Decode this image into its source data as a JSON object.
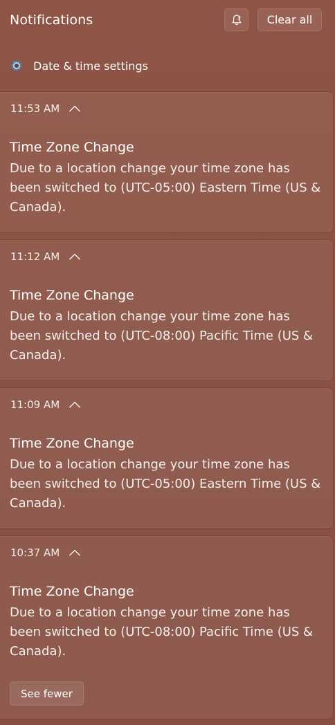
{
  "panel": {
    "title": "Notifications",
    "dnd_icon": "snooze-bell-icon",
    "clear_all_label": "Clear all"
  },
  "group": {
    "icon": "gear-icon",
    "label": "Date & time settings"
  },
  "notifications": [
    {
      "time": "11:53 AM",
      "title": "Time Zone Change",
      "body": "Due to a location change your time zone has been switched to (UTC-05:00) Eastern Time (US & Canada)."
    },
    {
      "time": "11:12 AM",
      "title": "Time Zone Change",
      "body": "Due to a location change your time zone has been switched to (UTC-08:00) Pacific Time (US & Canada)."
    },
    {
      "time": "11:09 AM",
      "title": "Time Zone Change",
      "body": "Due to a location change your time zone has been switched to (UTC-05:00) Eastern Time (US & Canada)."
    },
    {
      "time": "10:37 AM",
      "title": "Time Zone Change",
      "body": "Due to a location change your time zone has been switched to (UTC-08:00) Pacific Time (US & Canada)."
    }
  ],
  "see_fewer_label": "See fewer",
  "colors": {
    "background": "#8a5244",
    "text": "#ffffff",
    "gear_accent": "#3a8fd6"
  }
}
